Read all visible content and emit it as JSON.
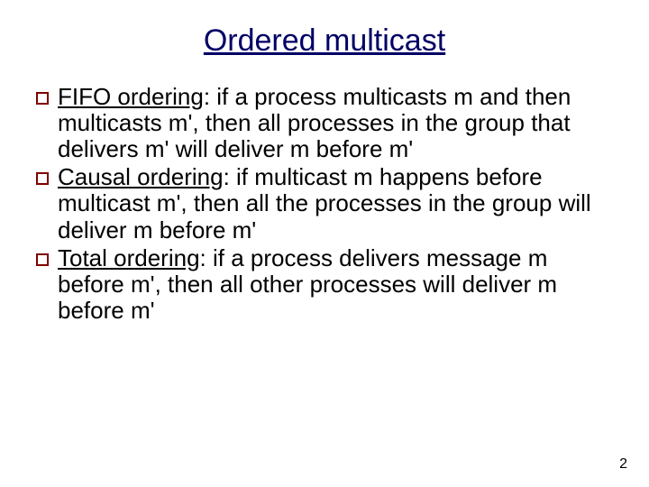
{
  "title": "Ordered multicast",
  "bullets": [
    {
      "label": "FIFO ordering",
      "rest": ": if a process multicasts m and then multicasts m', then all processes in the group that delivers m' will deliver m before m'"
    },
    {
      "label": "Causal ordering",
      "rest": ": if multicast m happens before multicast m', then all the processes in the group will deliver m before m'"
    },
    {
      "label": "Total ordering",
      "rest": ": if a process delivers message m before m', then all other processes will deliver m before m'"
    }
  ],
  "page_number": "2"
}
